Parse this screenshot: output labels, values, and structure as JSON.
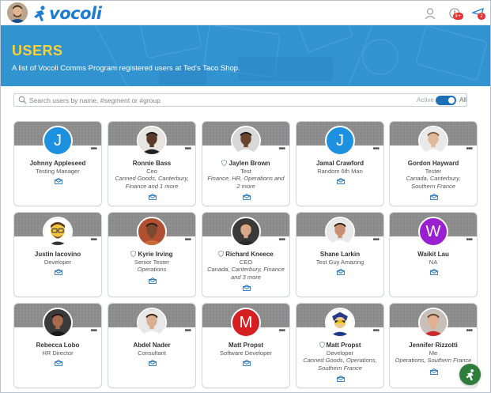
{
  "app": {
    "logo_text": "vocoli",
    "brand_color": "#1d7ed1",
    "badges": {
      "notifications": "9+",
      "announcements": "2"
    }
  },
  "hero": {
    "title": "USERS",
    "subtitle": "A list of Vocoli Comms Program registered users at Ted's Taco Shop."
  },
  "search": {
    "placeholder": "Search users by name, #segment or #group",
    "value": "",
    "toggle_left": "Active",
    "toggle_right": "All",
    "toggle_on": true
  },
  "users": [
    {
      "name": "Johnny Appleseed",
      "title": "Testing Manager",
      "groups": "",
      "avatar": "letter",
      "letter": "J",
      "color": "#1e90e0",
      "shield": false
    },
    {
      "name": "Ronnie Bass",
      "title": "Ceo",
      "groups": "Canned Goods, Canterbury, Finance and 1 more",
      "avatar": "photo",
      "skin": "#5a3a2a",
      "bg": "#e8e4e0",
      "hair": "#1a1a1a",
      "shirt": "#222222",
      "shield": false
    },
    {
      "name": "Jaylen Brown",
      "title": "Test",
      "groups": "Finance, HR, Operations and 2 more",
      "avatar": "photo",
      "skin": "#6b4430",
      "bg": "#d8d8d8",
      "hair": "#1a1a1a",
      "shirt": "#ffffff",
      "shield": true
    },
    {
      "name": "Jamal Crawford",
      "title": "Random 6th Man",
      "groups": "",
      "avatar": "letter",
      "letter": "J",
      "color": "#1e90e0",
      "shield": false
    },
    {
      "name": "Gordon Hayward",
      "title": "Tester",
      "groups": "Canada, Canterbury, Southern France",
      "avatar": "photo",
      "skin": "#e0b89a",
      "bg": "#e9e9e9",
      "hair": "#7a5a3a",
      "shirt": "#ffffff",
      "shield": false
    },
    {
      "name": "Justin Iacovino",
      "title": "Developer",
      "groups": "",
      "avatar": "cartoon",
      "skin": "#f4c542",
      "bg": "#ffffff",
      "hair": "#5a3a1a",
      "shirt": "#333333",
      "shield": false
    },
    {
      "name": "Kyrie Irving",
      "title": "Senior Tester",
      "groups": "Operations",
      "avatar": "photo",
      "skin": "#7a4a30",
      "bg": "#b05030",
      "hair": "#2a1a10",
      "shirt": "#c86a3a",
      "shield": true
    },
    {
      "name": "Richard Kneece",
      "title": "CEO",
      "groups": "Canada, Canterbury, Finance and 3 more",
      "avatar": "photo",
      "skin": "#d8a888",
      "bg": "#3a3a3a",
      "hair": "#4a3020",
      "shirt": "#2a2a2a",
      "shield": true
    },
    {
      "name": "Shane Larkin",
      "title": "Test Guy Amazing",
      "groups": "",
      "avatar": "photo",
      "skin": "#c89070",
      "bg": "#e8e8e8",
      "hair": "#2a1a10",
      "shirt": "#ffffff",
      "shield": false
    },
    {
      "name": "Waikit Lau",
      "title": "NA",
      "groups": "",
      "avatar": "letter",
      "letter": "W",
      "color": "#9a1fd0",
      "shield": false
    },
    {
      "name": "Rebecca Lobo",
      "title": "HR Director",
      "groups": "",
      "avatar": "photo",
      "skin": "#a86a4a",
      "bg": "#3a3a3a",
      "hair": "#1a1010",
      "shirt": "#1a1a1a",
      "shield": false
    },
    {
      "name": "Abdel Nader",
      "title": "Consultant",
      "groups": "",
      "avatar": "photo",
      "skin": "#d8b090",
      "bg": "#e8e8e8",
      "hair": "#2a1a10",
      "shirt": "#ffffff",
      "shield": false
    },
    {
      "name": "Matt Propst",
      "title": "Software Developer",
      "groups": "",
      "avatar": "letter",
      "letter": "M",
      "color": "#d42020",
      "shield": false
    },
    {
      "name": "Matt Propst",
      "title": "Developer",
      "groups": "Canned Goods, Operations, Southern France",
      "avatar": "cartoon2",
      "skin": "#f0c890",
      "bg": "#ffffff",
      "hair": "#2a3a8a",
      "shirt": "#1a3a8a",
      "shield": true
    },
    {
      "name": "Jennifer Rizzotti",
      "title": "Me",
      "groups": "Operations, Southern France",
      "avatar": "photo",
      "skin": "#e0b090",
      "bg": "#c8c0b8",
      "hair": "#5a3a2a",
      "shirt": "#cc2a2a",
      "shield": false
    }
  ]
}
